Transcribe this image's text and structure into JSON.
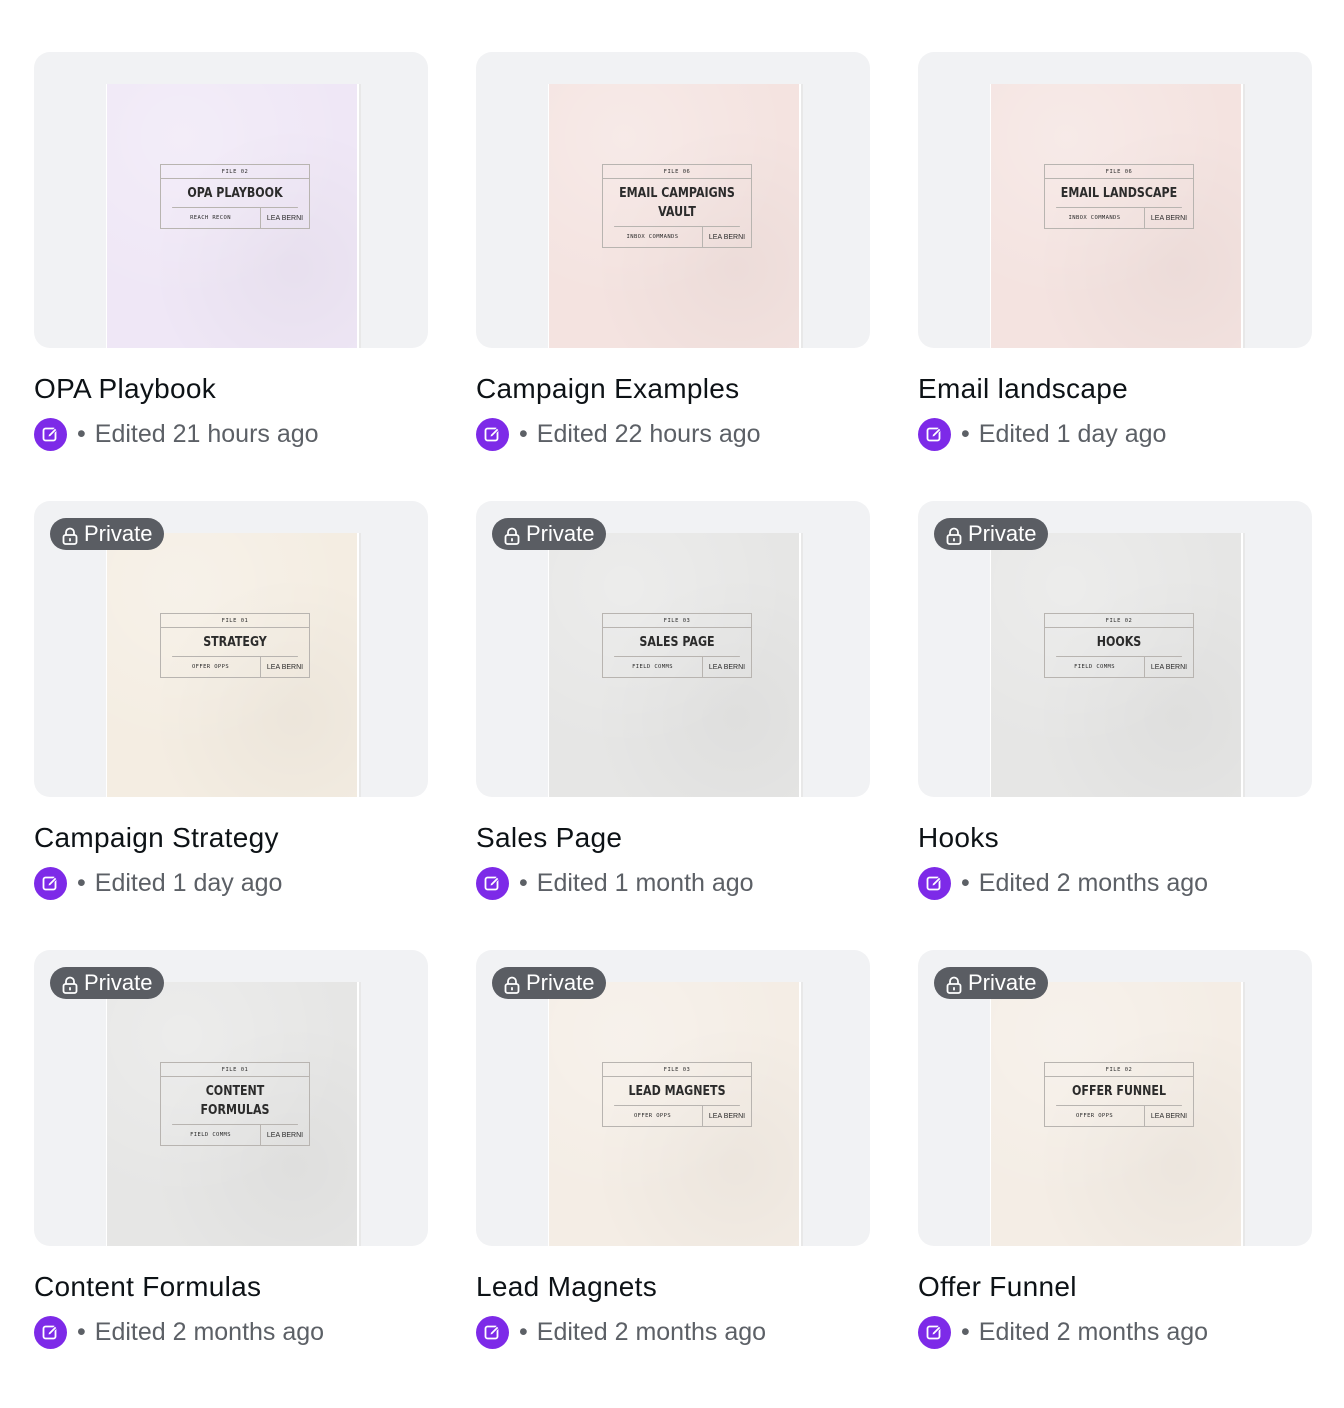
{
  "private_label": "Private",
  "accent_color": "#7d2ae8",
  "badge_color": "#5a5d63",
  "cards": [
    {
      "title": "OPA Playbook",
      "edited": "Edited 21 hours ago",
      "private": false,
      "thumb": {
        "file": "FILE 02",
        "heading": "OPA PLAYBOOK",
        "sub": "REACH RECON",
        "logo": "LEA BERNI",
        "color": "#efe7f6"
      }
    },
    {
      "title": "Campaign Examples",
      "edited": "Edited 22 hours ago",
      "private": false,
      "thumb": {
        "file": "FILE 06",
        "heading": "EMAIL CAMPAIGNS VAULT",
        "sub": "INBOX COMMANDS",
        "logo": "LEA BERNI",
        "color": "#f4e3e0"
      }
    },
    {
      "title": "Email landscape",
      "edited": "Edited 1 day ago",
      "private": false,
      "thumb": {
        "file": "FILE 06",
        "heading": "EMAIL LANDSCAPE",
        "sub": "INBOX COMMANDS",
        "logo": "LEA BERNI",
        "color": "#f4e3e0"
      }
    },
    {
      "title": "Campaign Strategy",
      "edited": "Edited 1 day ago",
      "private": true,
      "thumb": {
        "file": "FILE 01",
        "heading": "STRATEGY",
        "sub": "OFFER OPPS",
        "logo": "LEA BERNI",
        "color": "#f4ede2"
      }
    },
    {
      "title": "Sales Page",
      "edited": "Edited 1 month ago",
      "private": true,
      "thumb": {
        "file": "FILE 03",
        "heading": "SALES PAGE",
        "sub": "FIELD COMMS",
        "logo": "LEA BERNI",
        "color": "#e6e6e5"
      }
    },
    {
      "title": "Hooks",
      "edited": "Edited 2 months ago",
      "private": true,
      "thumb": {
        "file": "FILE 02",
        "heading": "HOOKS",
        "sub": "FIELD COMMS",
        "logo": "LEA BERNI",
        "color": "#e6e6e5"
      }
    },
    {
      "title": "Content Formulas",
      "edited": "Edited 2 months ago",
      "private": true,
      "thumb": {
        "file": "FILE 01",
        "heading": "CONTENT FORMULAS",
        "sub": "FIELD COMMS",
        "logo": "LEA BERNI",
        "color": "#e6e6e5"
      }
    },
    {
      "title": "Lead Magnets",
      "edited": "Edited 2 months ago",
      "private": true,
      "thumb": {
        "file": "FILE 03",
        "heading": "LEAD MAGNETS",
        "sub": "OFFER OPPS",
        "logo": "LEA BERNI",
        "color": "#f4ede5"
      }
    },
    {
      "title": "Offer Funnel",
      "edited": "Edited 2 months ago",
      "private": true,
      "thumb": {
        "file": "FILE 02",
        "heading": "OFFER FUNNEL",
        "sub": "OFFER OPPS",
        "logo": "LEA BERNI",
        "color": "#f4ede5"
      }
    }
  ]
}
